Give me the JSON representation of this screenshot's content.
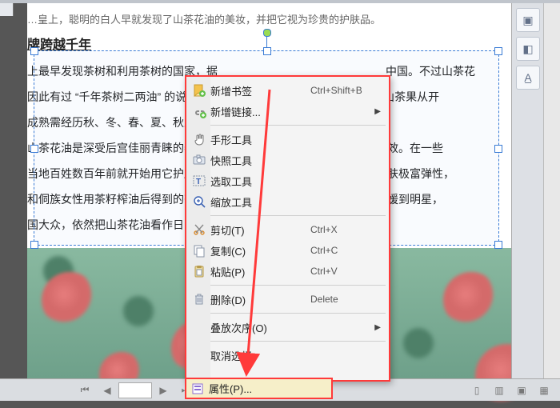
{
  "document": {
    "line0": "…皇上，聪明的白人早就发现了山茶花油的美妆，并把它视为珍贵的护肤品。",
    "heading": "牌跨越千年",
    "p1a": "上最早发现茶树和利用茶树的国家，据",
    "p1b": "中国。不过山茶花",
    "p2a": "因此有过 “千年茶树二两油” 的说法。究其原因",
    "p2b": "年，而山茶果从开",
    "p3a": "成熟需经历秋、冬、春、夏、秋五季，",
    "p4a": "山茶花油是深受后宫佳丽青睐的养颜秘",
    "p4b": "美容妙效。在一些",
    "p5a": "当地百姓数百年前就开始用它护肤。譬",
    "p5b": "浴，皮肤极富弹性，",
    "p6a": "和侗族女性用茶籽榨油后得到的茶枯洗",
    "p6b": "，从名媛到明星，",
    "p7a": "国大众，依然把山茶花油看作日常护肤"
  },
  "context_menu": {
    "items": [
      {
        "icon": "bookmark-add",
        "label": "新增书签",
        "shortcut": "Ctrl+Shift+B",
        "submenu": false
      },
      {
        "icon": "link-add",
        "label": "新增链接...",
        "shortcut": "",
        "submenu": true
      },
      {
        "sep": true
      },
      {
        "icon": "hand",
        "label": "手形工具",
        "shortcut": "",
        "submenu": false
      },
      {
        "icon": "camera",
        "label": "快照工具",
        "shortcut": "",
        "submenu": false
      },
      {
        "icon": "text-select",
        "label": "选取工具",
        "shortcut": "",
        "submenu": false
      },
      {
        "icon": "zoom",
        "label": "缩放工具",
        "shortcut": "",
        "submenu": false
      },
      {
        "sep": true
      },
      {
        "icon": "cut",
        "label": "剪切(T)",
        "shortcut": "Ctrl+X",
        "submenu": false
      },
      {
        "icon": "copy",
        "label": "复制(C)",
        "shortcut": "Ctrl+C",
        "submenu": false
      },
      {
        "icon": "paste",
        "label": "粘贴(P)",
        "shortcut": "Ctrl+V",
        "submenu": false
      },
      {
        "sep": true
      },
      {
        "icon": "delete",
        "label": "删除(D)",
        "shortcut": "Delete",
        "submenu": false
      },
      {
        "sep": true
      },
      {
        "icon": "",
        "label": "叠放次序(O)",
        "shortcut": "",
        "submenu": true
      },
      {
        "sep": true
      },
      {
        "icon": "",
        "label": "取消选择",
        "shortcut": "",
        "submenu": false
      }
    ]
  },
  "properties_button": {
    "label": "属性(P)..."
  },
  "bottom_bar": {
    "page_current": ""
  },
  "colors": {
    "highlight_border": "#ff3a3a",
    "selection": "#3a7bd5"
  }
}
